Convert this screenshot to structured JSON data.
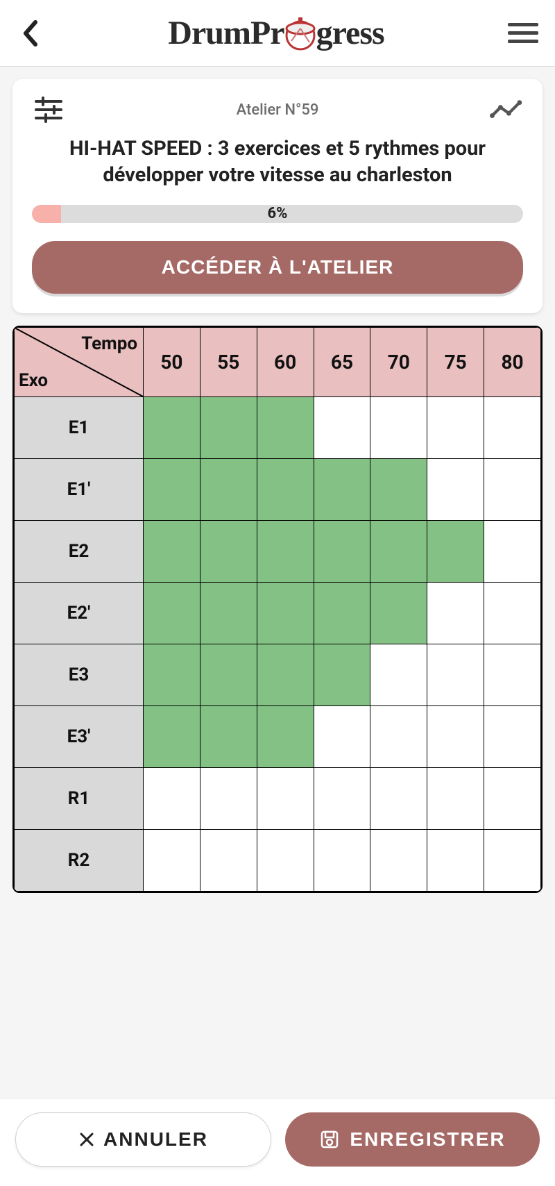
{
  "header": {
    "logo_part1": "DrumPr",
    "logo_part2": "gress"
  },
  "card": {
    "subtitle": "Atelier N°59",
    "title": "HI-HAT SPEED : 3 exercices et 5 rythmes pour développer votre vitesse au charleston",
    "progress_percent": 6,
    "progress_text": "6%",
    "access_label": "ACCÉDER À L'ATELIER"
  },
  "table": {
    "corner_top": "Tempo",
    "corner_bottom": "Exo",
    "tempos": [
      "50",
      "55",
      "60",
      "65",
      "70",
      "75",
      "80"
    ],
    "rows": [
      {
        "label": "E1",
        "done": [
          true,
          true,
          true,
          false,
          false,
          false,
          false
        ]
      },
      {
        "label": "E1'",
        "done": [
          true,
          true,
          true,
          true,
          true,
          false,
          false
        ]
      },
      {
        "label": "E2",
        "done": [
          true,
          true,
          true,
          true,
          true,
          true,
          false
        ]
      },
      {
        "label": "E2'",
        "done": [
          true,
          true,
          true,
          true,
          true,
          false,
          false
        ]
      },
      {
        "label": "E3",
        "done": [
          true,
          true,
          true,
          true,
          false,
          false,
          false
        ]
      },
      {
        "label": "E3'",
        "done": [
          true,
          true,
          true,
          false,
          false,
          false,
          false
        ]
      },
      {
        "label": "R1",
        "done": [
          false,
          false,
          false,
          false,
          false,
          false,
          false
        ]
      },
      {
        "label": "R2",
        "done": [
          false,
          false,
          false,
          false,
          false,
          false,
          false
        ]
      }
    ]
  },
  "footer": {
    "cancel_label": "ANNULER",
    "save_label": "ENREGISTRER"
  }
}
